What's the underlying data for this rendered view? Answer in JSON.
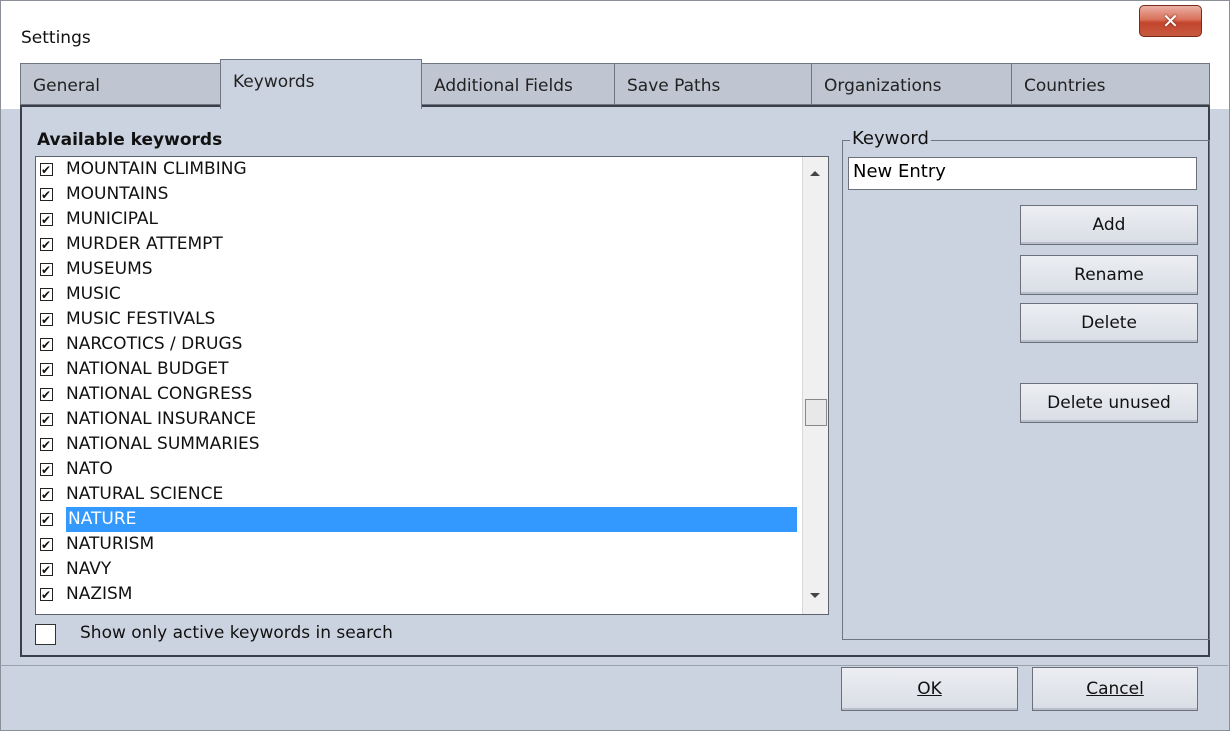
{
  "window": {
    "title": "Settings",
    "close_glyph": "✕"
  },
  "tabs": [
    {
      "label": "General"
    },
    {
      "label": "Keywords"
    },
    {
      "label": "Additional Fields"
    },
    {
      "label": "Save Paths"
    },
    {
      "label": "Organizations"
    },
    {
      "label": "Countries"
    }
  ],
  "keywords_panel": {
    "available_label": "Available keywords",
    "items": [
      {
        "label": "MOUNTAIN CLIMBING",
        "checked": true
      },
      {
        "label": "MOUNTAINS",
        "checked": true
      },
      {
        "label": "MUNICIPAL",
        "checked": true
      },
      {
        "label": "MURDER ATTEMPT",
        "checked": true
      },
      {
        "label": "MUSEUMS",
        "checked": true
      },
      {
        "label": "MUSIC",
        "checked": true
      },
      {
        "label": "MUSIC FESTIVALS",
        "checked": true
      },
      {
        "label": "NARCOTICS / DRUGS",
        "checked": true
      },
      {
        "label": "NATIONAL BUDGET",
        "checked": true
      },
      {
        "label": "NATIONAL CONGRESS",
        "checked": true
      },
      {
        "label": "NATIONAL INSURANCE",
        "checked": true
      },
      {
        "label": "NATIONAL SUMMARIES",
        "checked": true
      },
      {
        "label": "NATO",
        "checked": true
      },
      {
        "label": "NATURAL SCIENCE",
        "checked": true
      },
      {
        "label": "NATURE",
        "checked": true,
        "selected": true
      },
      {
        "label": "NATURISM",
        "checked": true
      },
      {
        "label": "NAVY",
        "checked": true
      },
      {
        "label": "NAZISM",
        "checked": true
      }
    ],
    "show_active_label": "Show only active keywords in search",
    "show_active_checked": false
  },
  "keyword_group": {
    "legend": "Keyword",
    "input_value": "New Entry",
    "add_label": "Add",
    "rename_label": "Rename",
    "delete_label": "Delete",
    "delete_unused_label": "Delete unused"
  },
  "footer": {
    "ok_label": "OK",
    "cancel_label": "Cancel"
  },
  "colors": {
    "background": "#ccd3e0",
    "selection": "#3399ff",
    "close_button": "#c75a40"
  }
}
